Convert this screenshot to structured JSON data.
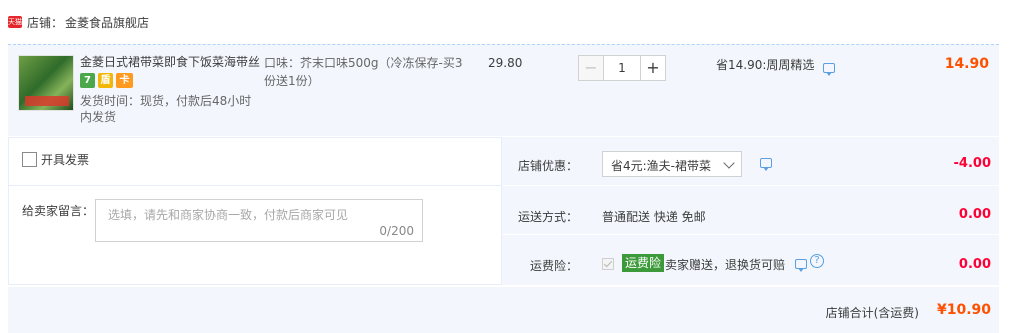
{
  "shop": {
    "badge": "天猫",
    "label": "店铺：",
    "name": "金菱食品旗舰店"
  },
  "item": {
    "title": "金菱日式裙带菜即食下饭菜海带丝",
    "services": [
      "7",
      "盾",
      "卡"
    ],
    "ship_time": "发货时间：现货，付款后48小时内发货",
    "sku": "口味：芥末口味500g（冷冻保存-买3份送1份）",
    "unit_price": "29.80",
    "quantity": "1",
    "minus_label": "−",
    "plus_label": "+",
    "promo": "省14.90:周周精选",
    "subtotal": "14.90"
  },
  "invoice": {
    "label": "开具发票"
  },
  "message": {
    "label": "给卖家留言：",
    "placeholder": "选填，请先和商家协商一致，付款后商家可见",
    "count": "0/200"
  },
  "coupon": {
    "label": "店铺优惠：",
    "selected": "省4元:渔夫-裙带菜",
    "amount": "-4.00"
  },
  "shipping": {
    "label": "运送方式：",
    "method": "普通配送 快递 免邮",
    "amount": "0.00"
  },
  "insurance": {
    "label": "运费险：",
    "badge": "运费险",
    "text": "卖家赠送，退换货可赔",
    "help": "?",
    "amount": "0.00"
  },
  "total": {
    "label": "店铺合计(含运费)",
    "value": "¥10.90"
  },
  "colors": {
    "accent_orange": "#ff5000",
    "discount_red": "#ff0036",
    "panel_bg": "#f3f7fd",
    "insurance_green": "#3d9a3a"
  }
}
